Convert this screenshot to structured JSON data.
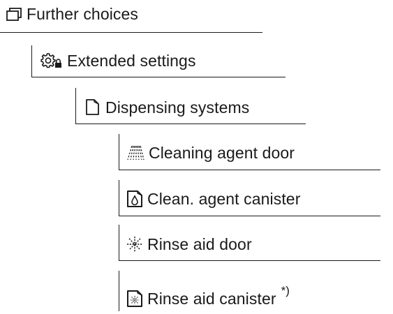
{
  "menu": {
    "further_choices": {
      "label": "Further choices",
      "icon": "window-stack-icon"
    },
    "extended_settings": {
      "label": "Extended settings",
      "icon": "gear-lock-icon"
    },
    "dispensing_systems": {
      "label": "Dispensing systems",
      "icon": "canister-outline-icon"
    },
    "items": [
      {
        "label": "Cleaning agent door",
        "icon": "spray-lines-icon"
      },
      {
        "label": "Clean. agent canister",
        "icon": "canister-drop-icon"
      },
      {
        "label": "Rinse aid door",
        "icon": "rinse-aid-star-icon"
      },
      {
        "label": "Rinse aid canister",
        "icon": "canister-rinse-aid-icon",
        "footnote": "*)"
      }
    ]
  }
}
